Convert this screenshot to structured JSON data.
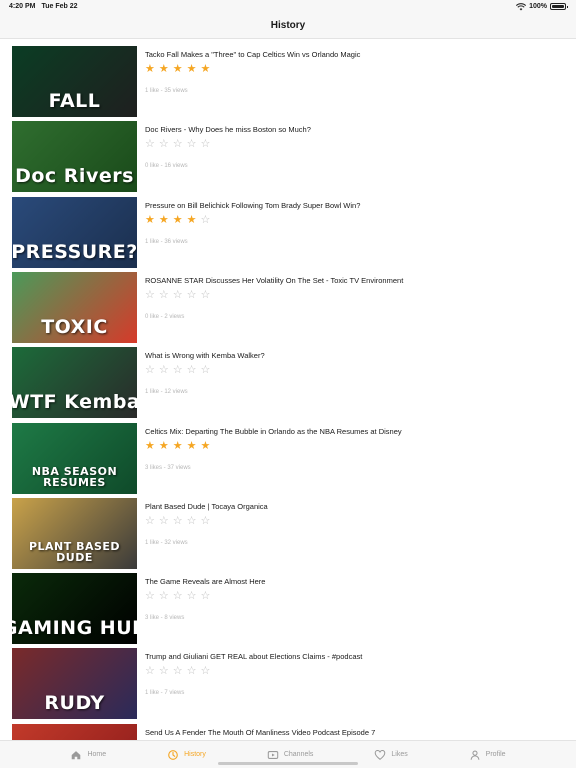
{
  "status": {
    "time": "4:20 PM",
    "date": "Tue Feb 22",
    "battery": "100%",
    "battery_level": 1.0
  },
  "nav": {
    "title": "History"
  },
  "items": [
    {
      "title": "Tacko Fall Makes a \"Three\" to Cap Celtics Win vs Orlando Magic",
      "rating": 5,
      "meta": "1 like - 35 views",
      "thumb_text": "FALL",
      "thumb_colors": [
        "#0b3d24",
        "#1f1f1f"
      ]
    },
    {
      "title": "Doc Rivers - Why Does he miss Boston so Much?",
      "rating": 0,
      "meta": "0 like - 16 views",
      "thumb_text": "Doc Rivers",
      "thumb_colors": [
        "#2f6e2f",
        "#1a4a1a"
      ]
    },
    {
      "title": "Pressure on Bill Belichick Following Tom Brady Super Bowl Win?",
      "rating": 4,
      "meta": "1 like - 36 views",
      "thumb_text": "PRESSURE?",
      "thumb_colors": [
        "#2a4a7a",
        "#1b2f4e"
      ]
    },
    {
      "title": "ROSANNE STAR Discusses Her Volatility On The Set - Toxic TV Environment",
      "rating": 0,
      "meta": "0 like - 2 views",
      "thumb_text": "TOXIC",
      "thumb_colors": [
        "#4a9a5a",
        "#d63a2a"
      ]
    },
    {
      "title": "What is Wrong with Kemba Walker?",
      "rating": 0,
      "meta": "1 like - 12 views",
      "thumb_text": "WTF Kemba",
      "thumb_colors": [
        "#1c6b3a",
        "#2a2a2a"
      ]
    },
    {
      "title": "Celtics Mix: Departing The Bubble in Orlando as the NBA Resumes at Disney",
      "rating": 5,
      "meta": "3 likes - 37 views",
      "thumb_text": "NBA SEASON RESUMES",
      "thumb_colors": [
        "#1e7a46",
        "#0f4a2a"
      ]
    },
    {
      "title": "Plant Based Dude | Tocaya Organica",
      "rating": 0,
      "meta": "1 like - 32 views",
      "thumb_text": "PLANT BASED DUDE",
      "thumb_colors": [
        "#c9a24a",
        "#3a3a3a"
      ]
    },
    {
      "title": "The Game Reveals are Almost Here",
      "rating": 0,
      "meta": "3 like - 8 views",
      "thumb_text": "GAMING HUB",
      "thumb_colors": [
        "#0a2a0a",
        "#000000"
      ]
    },
    {
      "title": "Trump and Giuliani GET REAL about Elections Claims - #podcast",
      "rating": 0,
      "meta": "1 like - 7 views",
      "thumb_text": "RUDY",
      "thumb_colors": [
        "#7a2a2a",
        "#2a2a5a"
      ]
    },
    {
      "title": "Send Us A Fender The Mouth Of Manliness Video Podcast Episode 7",
      "rating": 0,
      "meta": "",
      "thumb_text": "",
      "thumb_colors": [
        "#c23a2a",
        "#8a1a1a"
      ]
    }
  ],
  "tabs": [
    {
      "label": "Home",
      "icon": "home-icon",
      "active": false
    },
    {
      "label": "History",
      "icon": "history-icon",
      "active": true
    },
    {
      "label": "Channels",
      "icon": "channels-icon",
      "active": false
    },
    {
      "label": "Likes",
      "icon": "heart-icon",
      "active": false
    },
    {
      "label": "Profile",
      "icon": "profile-icon",
      "active": false
    }
  ],
  "colors": {
    "accent": "#f5a623",
    "star_empty": "#bdbdbd",
    "inactive": "#9a9a9a"
  }
}
